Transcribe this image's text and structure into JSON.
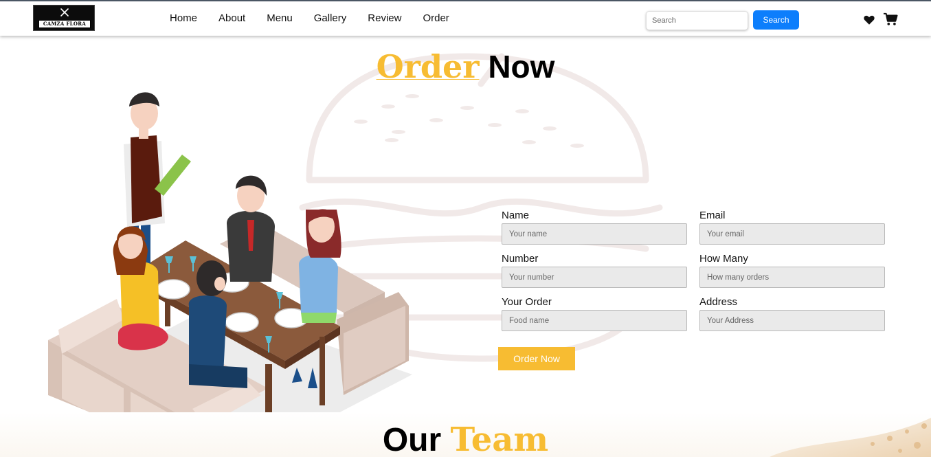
{
  "brand": {
    "logo_text": "CAMZA FLORA"
  },
  "nav": {
    "links": [
      "Home",
      "About",
      "Menu",
      "Gallery",
      "Review",
      "Order"
    ],
    "search_placeholder": "Search",
    "search_button": "Search",
    "icons": [
      "heart-icon",
      "cart-icon"
    ]
  },
  "order_section": {
    "title_accent": "Order",
    "title_rest": "Now",
    "form": {
      "name_label": "Name",
      "name_placeholder": "Your name",
      "email_label": "Email",
      "email_placeholder": "Your email",
      "number_label": "Number",
      "number_placeholder": "Your number",
      "how_many_label": "How Many",
      "how_many_placeholder": "How many orders",
      "order_label": "Your Order",
      "order_placeholder": "Food name",
      "address_label": "Address",
      "address_placeholder": "Your Address",
      "submit_label": "Order Now"
    }
  },
  "team_section": {
    "title_dark": "Our",
    "title_accent": "Team"
  },
  "colors": {
    "accent": "#f7bc32",
    "search_button": "#0d7efc",
    "input_bg": "#eaeaea"
  }
}
